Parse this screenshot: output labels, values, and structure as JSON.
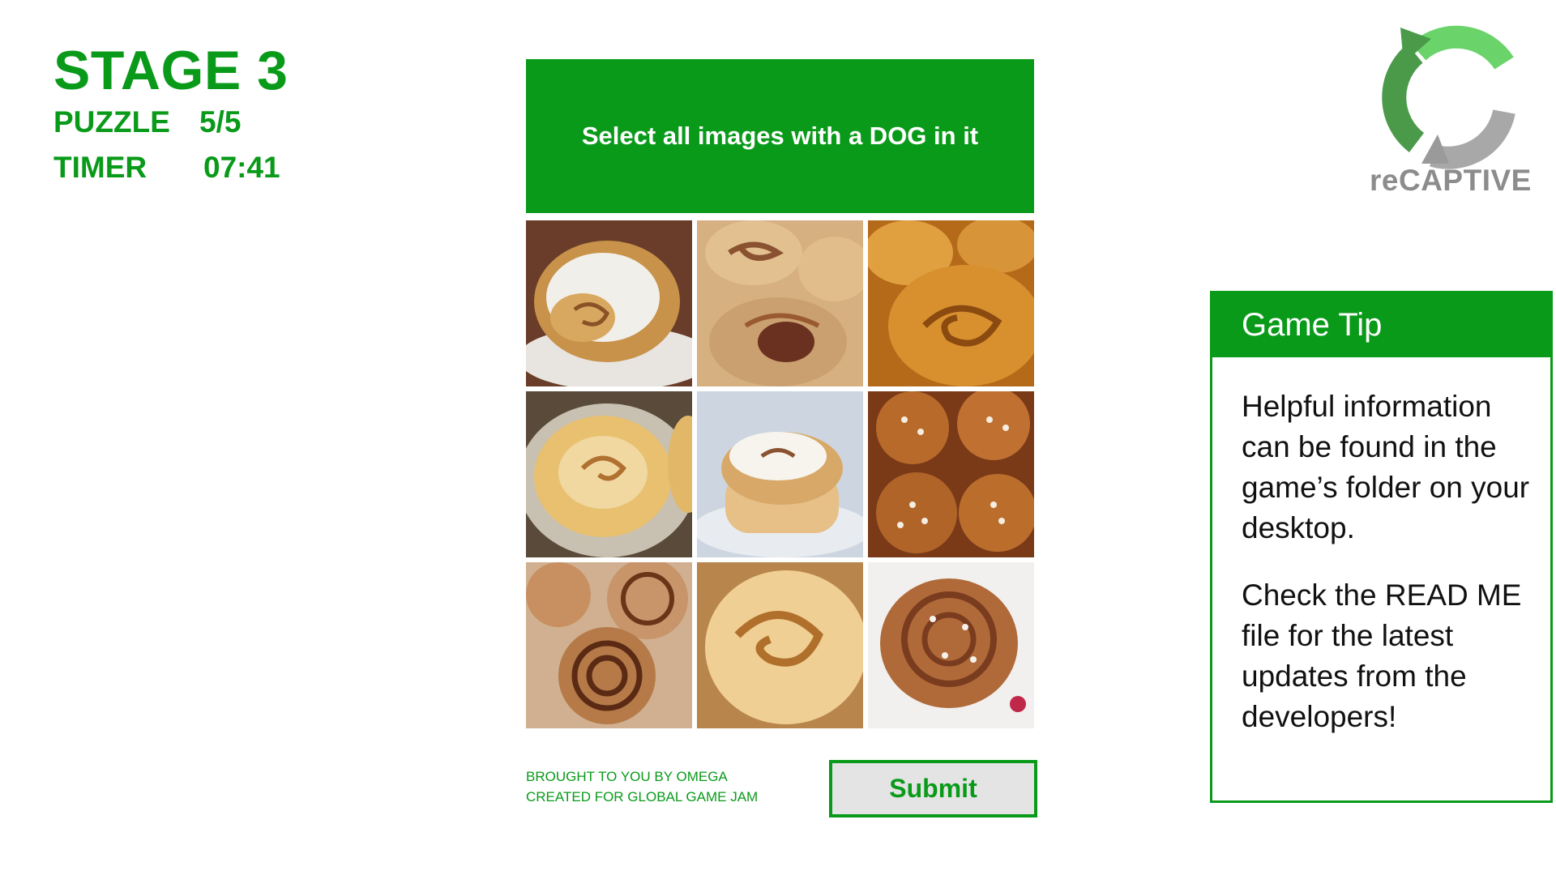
{
  "hud": {
    "stage": "STAGE 3",
    "puzzle_label": "PUZZLE",
    "puzzle_value": "5/5",
    "timer_label": "TIMER",
    "timer_value": "07:41"
  },
  "logo": {
    "text": "reCAPTIVE",
    "icon": "recycle-arrows-icon"
  },
  "captcha": {
    "prompt": "Select all images with a DOG in it",
    "tiles": [
      {
        "subject": "glazed cinnamon roll"
      },
      {
        "subject": "cinnamon cookies"
      },
      {
        "subject": "cinnamon buns"
      },
      {
        "subject": "glazed cinnamon roll on plate"
      },
      {
        "subject": "iced cinnamon roll"
      },
      {
        "subject": "sugar topped buns"
      },
      {
        "subject": "cinnamon rolls"
      },
      {
        "subject": "cinnamon roll close-up"
      },
      {
        "subject": "cardamom bun"
      }
    ],
    "submit_label": "Submit"
  },
  "credits": {
    "line1": "BROUGHT TO YOU BY OMEGA",
    "line2": "CREATED FOR GLOBAL GAME JAM"
  },
  "tip": {
    "title": "Game Tip",
    "paragraph1": "Helpful information can be found in the game’s folder on your desktop.",
    "paragraph2": "Check the READ ME file for the latest updates from the developers!"
  },
  "colors": {
    "accent": "#0a9a1a",
    "logo_gray": "#8c8c8c",
    "button_bg": "#e4e4e4"
  }
}
